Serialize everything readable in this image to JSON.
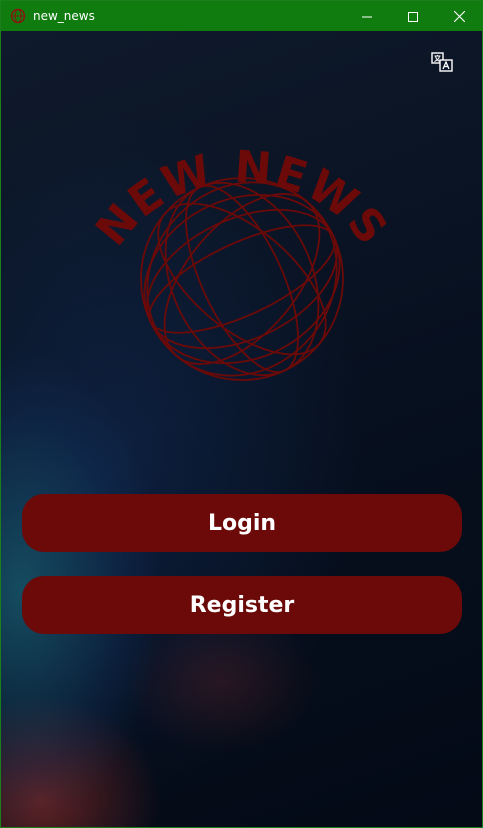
{
  "window": {
    "title": "new_news",
    "app_icon": "app-icon",
    "controls": [
      "minimize-icon",
      "maximize-icon",
      "close-icon"
    ],
    "titlebar_color": "#107c10"
  },
  "header": {
    "translate_icon": "translate-icon"
  },
  "logo": {
    "text": "NEW NEWS",
    "icon": "globe-icon",
    "color": "#6b0a08"
  },
  "actions": {
    "login_label": "Login",
    "register_label": "Register",
    "button_color": "#6b0a08"
  }
}
